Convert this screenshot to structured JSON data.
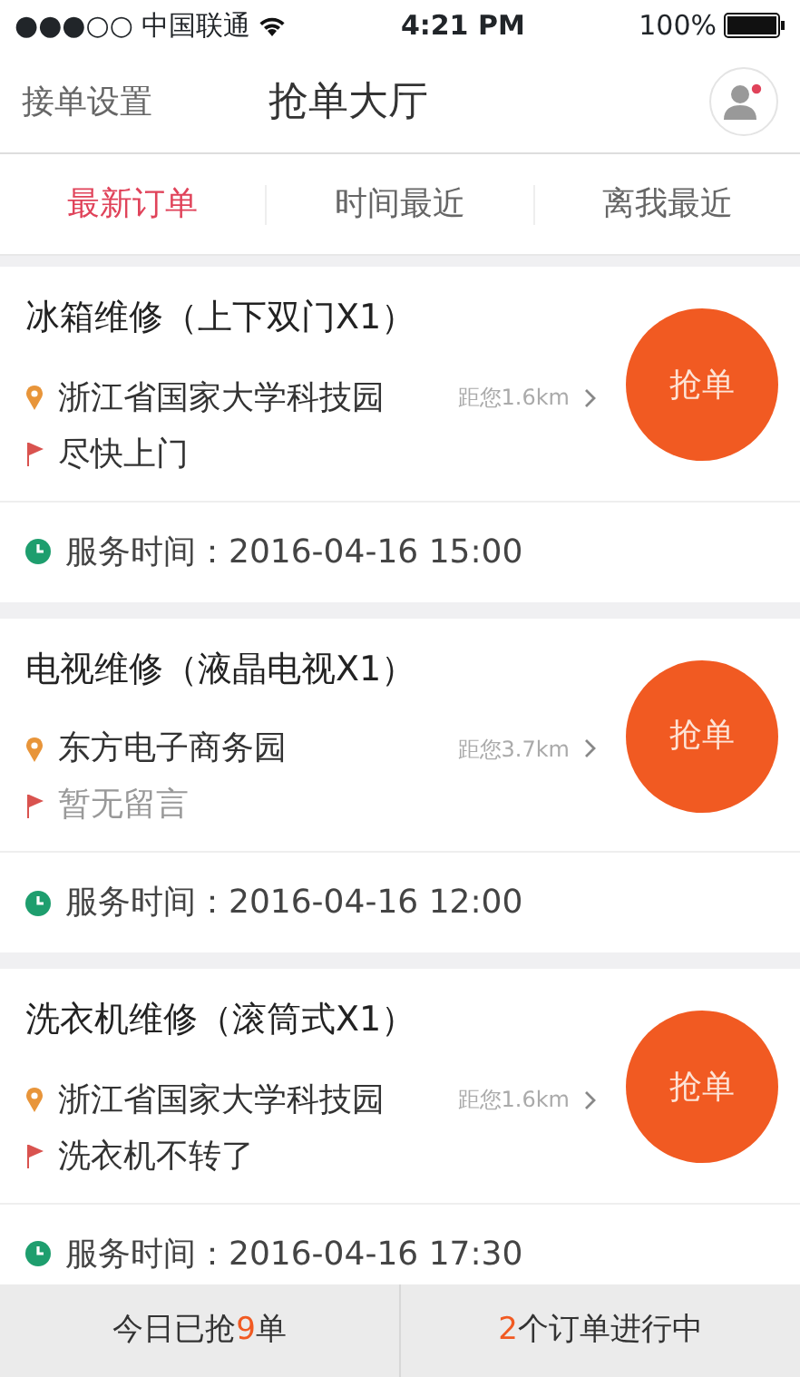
{
  "status_bar": {
    "carrier": "●●●○○ 中国联通",
    "time": "4:21 PM",
    "battery": "100%"
  },
  "header": {
    "left_link": "接单设置",
    "title": "抢单大厅",
    "has_notification": true
  },
  "tabs": [
    {
      "label": "最新订单",
      "selected": true
    },
    {
      "label": "时间最近",
      "selected": false
    },
    {
      "label": "离我最近",
      "selected": false
    }
  ],
  "orders": [
    {
      "title": "冰箱维修（上下双门X1）",
      "address": "浙江省国家大学科技园",
      "distance": "距您1.6km",
      "note": "尽快上门",
      "note_empty": false,
      "service_time": "服务时间：2016-04-16 15:00",
      "button": "抢单"
    },
    {
      "title": "电视维修（液晶电视X1）",
      "address": "东方电子商务园",
      "distance": "距您3.7km",
      "note": "暂无留言",
      "note_empty": true,
      "service_time": "服务时间：2016-04-16 12:00",
      "button": "抢单"
    },
    {
      "title": "洗衣机维修（滚筒式X1）",
      "address": "浙江省国家大学科技园",
      "distance": "距您1.6km",
      "note": "洗衣机不转了",
      "note_empty": false,
      "service_time": "服务时间：2016-04-16 17:30",
      "button": "抢单"
    }
  ],
  "footer": [
    {
      "before": "今日已抢",
      "count": "9",
      "after": "单"
    },
    {
      "count": "2",
      "after": "个订单进行中"
    }
  ]
}
